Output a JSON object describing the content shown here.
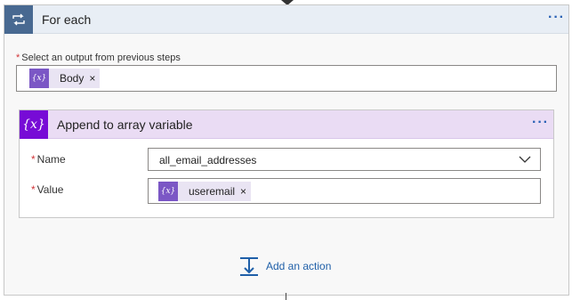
{
  "foreach": {
    "title": "For each",
    "more_label": "···",
    "select_label": "Select an output from previous steps",
    "required_mark": "*",
    "token": {
      "label": "Body",
      "remove": "×",
      "icon_text": "{x}"
    }
  },
  "append": {
    "title": "Append to array variable",
    "icon_text": "{x}",
    "more_label": "···",
    "name_label": "Name",
    "name_value": "all_email_addresses",
    "value_label": "Value",
    "value_token": {
      "label": "useremail",
      "remove": "×",
      "icon_text": "{x}"
    }
  },
  "add_action": {
    "label": "Add an action"
  },
  "colors": {
    "foreach_icon_bg": "#486991",
    "foreach_header_bg": "#e8eef5",
    "append_icon_bg": "#770bd6",
    "append_header_bg": "#eadcf4",
    "token_icon_bg": "#7b57c5",
    "token_bg": "#e9e4f3",
    "link": "#1f5fa8",
    "required": "#d13438"
  },
  "icons": {
    "foreach": "loop-icon",
    "append": "variable-icon",
    "token": "expression-icon",
    "dropdown": "chevron-down-icon",
    "add_action": "add-action-icon"
  }
}
